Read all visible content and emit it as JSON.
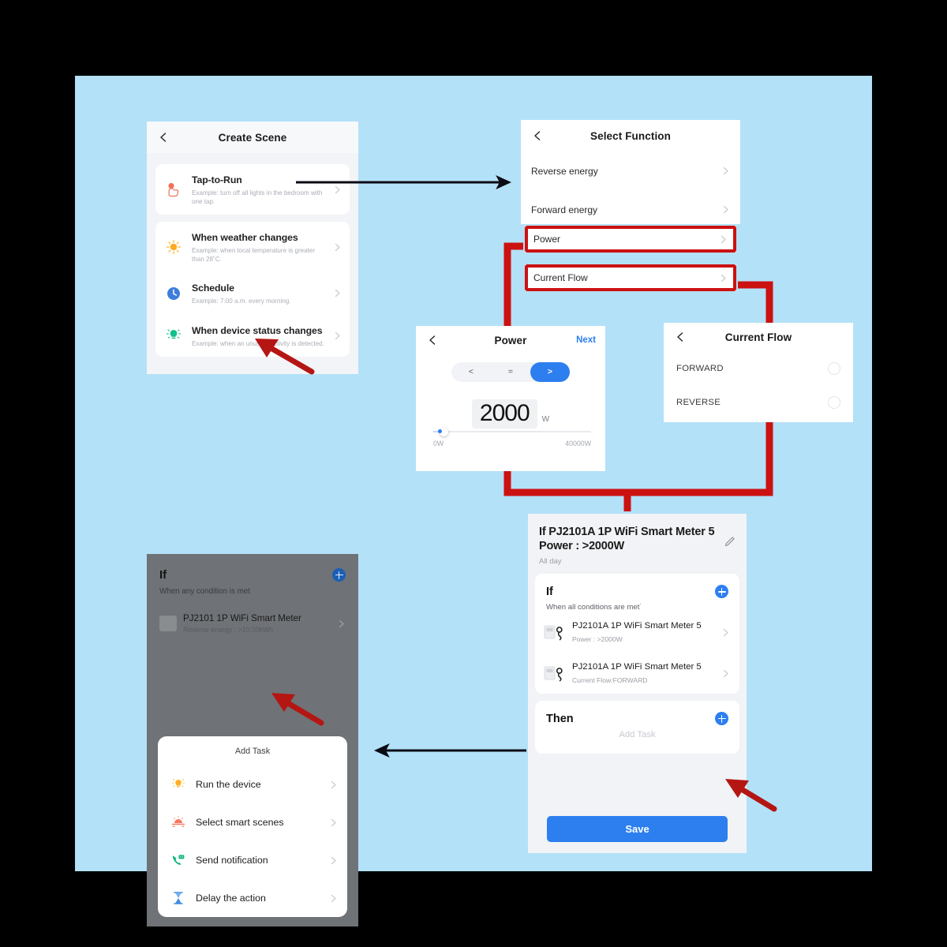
{
  "canvas": {
    "background": "#b3e1f8"
  },
  "accent": {
    "blue": "#2d7ff0",
    "red_highlight": "#cc1111",
    "arrow_black": "#0b0b14"
  },
  "create_scene": {
    "title": "Create Scene",
    "back_icon": "chevron-left-icon",
    "items": [
      {
        "icon": "tap-to-run-icon",
        "title": "Tap-to-Run",
        "subtitle": "Example: turn off all lights in the bedroom with one tap."
      },
      {
        "icon": "sun-weather-icon",
        "title": "When weather changes",
        "subtitle": "Example: when local temperature is greater than 28˚C."
      },
      {
        "icon": "clock-icon",
        "title": "Schedule",
        "subtitle": "Example: 7:00 a.m. every morning."
      },
      {
        "icon": "device-status-icon",
        "title": "When device status changes",
        "subtitle": "Example: when an unusual activity is detected."
      }
    ]
  },
  "select_function": {
    "title": "Select Function",
    "back_icon": "chevron-left-icon",
    "items": [
      {
        "label": "Reverse energy",
        "highlighted": false
      },
      {
        "label": "Forward energy",
        "highlighted": false
      },
      {
        "label": "Power",
        "highlighted": true
      },
      {
        "label": "Current Flow",
        "highlighted": true
      }
    ]
  },
  "power": {
    "title": "Power",
    "back_icon": "chevron-left-icon",
    "next_label": "Next",
    "operators": [
      {
        "label": "<",
        "selected": false
      },
      {
        "label": "=",
        "selected": false
      },
      {
        "label": ">",
        "selected": true
      }
    ],
    "value": "2000",
    "unit": "W",
    "slider_min_label": "0W",
    "slider_max_label": "40000W"
  },
  "current_flow": {
    "title": "Current Flow",
    "back_icon": "chevron-left-icon",
    "options": [
      {
        "label": "FORWARD",
        "selected": false
      },
      {
        "label": "REVERSE",
        "selected": false
      }
    ]
  },
  "summary": {
    "header_title": "If PJ2101A 1P WiFi Smart Meter  5 Power : >2000W",
    "header_sub": "All day",
    "edit_icon": "pencil-icon",
    "if_block": {
      "title": "If",
      "subtitle": "When all conditions are met˙",
      "add_icon": "plus-circle-icon",
      "conditions": [
        {
          "icon": "smart-meter-icon",
          "title": "PJ2101A 1P WiFi Smart Meter 5",
          "detail": "Power : >2000W"
        },
        {
          "icon": "smart-meter-icon",
          "title": "PJ2101A 1P WiFi Smart Meter 5",
          "detail": "Current Flow:FORWARD"
        }
      ]
    },
    "then_block": {
      "title": "Then",
      "add_icon": "plus-circle-icon",
      "placeholder": "Add Task"
    },
    "save_label": "Save"
  },
  "add_task": {
    "dimmed_if": {
      "title": "If",
      "add_icon": "plus-circle-icon",
      "subtitle": "When any condition is met",
      "device": {
        "icon": "smart-meter-icon",
        "title": "PJ2101 1P WiFi Smart Meter",
        "detail": "Reverse energy : >10.00kWh"
      }
    },
    "sheet_title": "Add Task",
    "options": [
      {
        "icon": "bulb-icon",
        "label": "Run the device"
      },
      {
        "icon": "scene-icon",
        "label": "Select smart scenes"
      },
      {
        "icon": "phone-message-icon",
        "label": "Send notification"
      },
      {
        "icon": "hourglass-icon",
        "label": "Delay the action"
      }
    ]
  },
  "annotations": {
    "arrow_create_to_select": "black-arrow-right",
    "arrow_summary_to_addtask": "black-arrow-left",
    "pointer_device_status": "red-arrow-pointer",
    "pointer_run_the_device": "red-arrow-pointer",
    "pointer_then_plus": "red-arrow-pointer"
  }
}
